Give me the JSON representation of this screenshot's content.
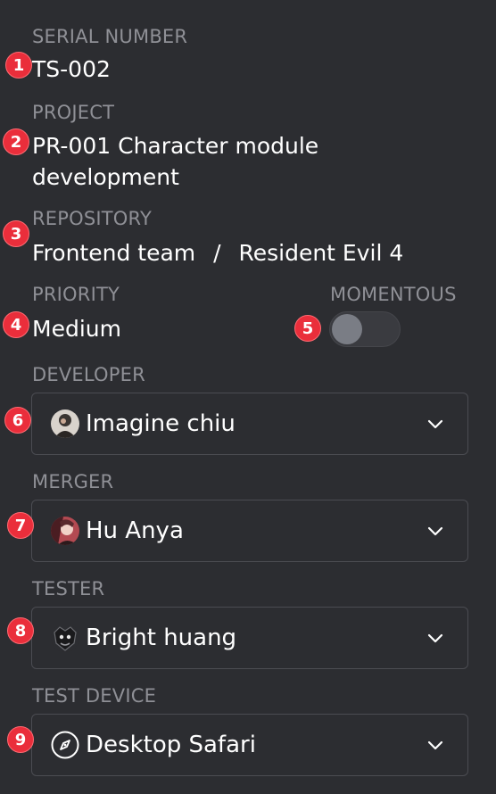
{
  "fields": {
    "serial": {
      "label": "SERIAL NUMBER",
      "value": "TS-002"
    },
    "project": {
      "label": "PROJECT",
      "value_line1": "PR-001 Character module",
      "value_line2": "development"
    },
    "repository": {
      "label": "REPOSITORY",
      "team": "Frontend team",
      "separator": "/",
      "repo": "Resident Evil 4"
    },
    "priority": {
      "label": "PRIORITY",
      "value": "Medium"
    },
    "momentous": {
      "label": "MOMENTOUS",
      "enabled": false
    },
    "developer": {
      "label": "DEVELOPER",
      "value": "Imagine chiu",
      "icon": "avatar-imagine-chiu"
    },
    "merger": {
      "label": "MERGER",
      "value": "Hu Anya",
      "icon": "avatar-hu-anya"
    },
    "tester": {
      "label": "TESTER",
      "value": "Bright huang",
      "icon": "avatar-bright-huang"
    },
    "test_device": {
      "label": "TEST DEVICE",
      "value": "Desktop Safari",
      "icon": "compass-icon"
    }
  },
  "badges": [
    "1",
    "2",
    "3",
    "4",
    "5",
    "6",
    "7",
    "8",
    "9"
  ],
  "colors": {
    "background": "#2c2d31",
    "label": "#8f9096",
    "badge": "#ea2e3b",
    "border": "#4b4c52"
  }
}
